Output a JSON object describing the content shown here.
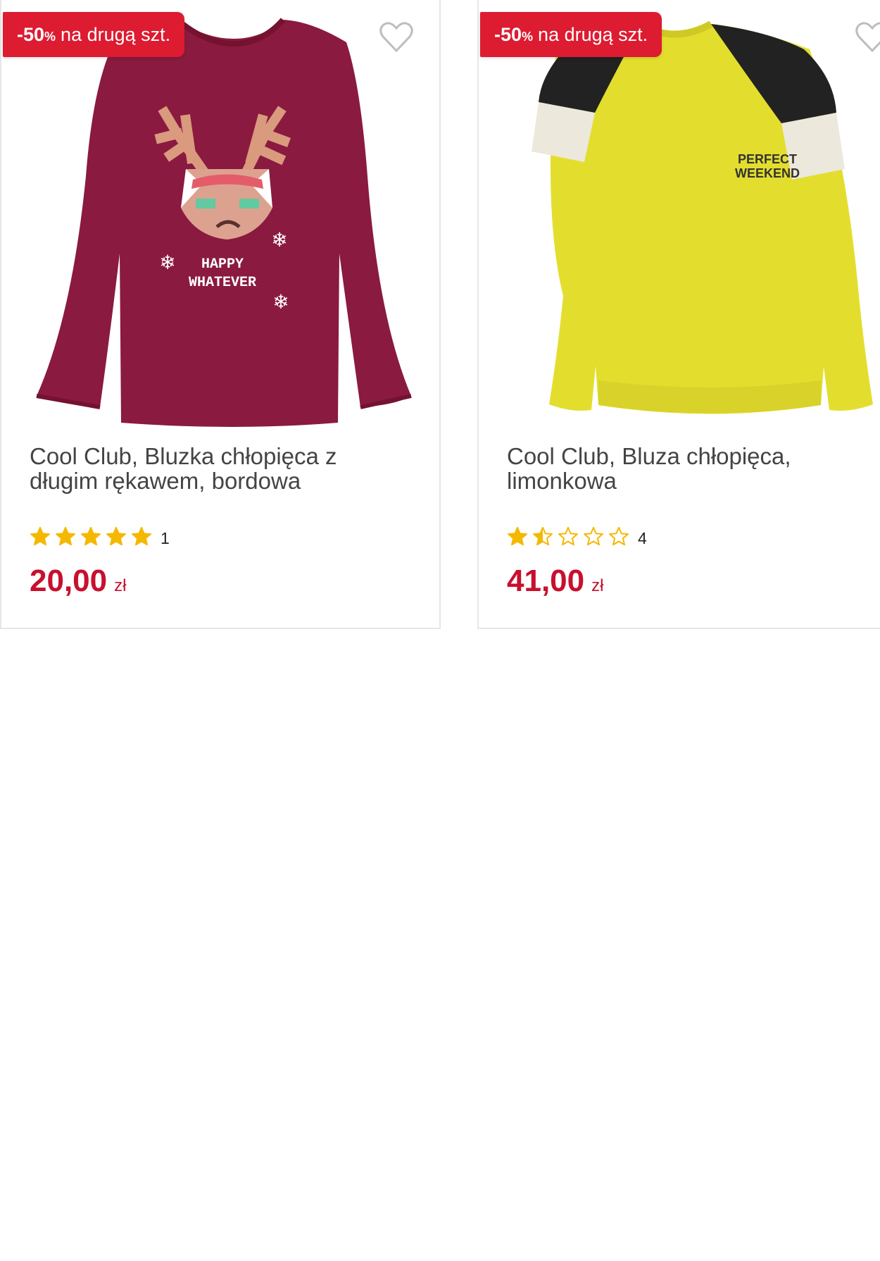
{
  "products": [
    {
      "badge": {
        "discount": "-50",
        "percent_sign": "%",
        "text": "na drugą szt."
      },
      "image_text": {
        "line1": "HAPPY",
        "line2": "WHATEVER"
      },
      "title": "Cool Club, Bluzka chłopięca z długim rękawem, bordowa",
      "rating": {
        "stars": 5,
        "max": 5,
        "count": "1"
      },
      "price": {
        "amount": "20,00",
        "currency": "zł"
      },
      "colors": {
        "garment": "#8a1a3f"
      }
    },
    {
      "badge": {
        "discount": "-50",
        "percent_sign": "%",
        "text": "na drugą szt."
      },
      "image_text": {
        "line1": "PERFECT",
        "line2": "WEEKEND"
      },
      "title": "Cool Club, Bluza chłopięca, limonkowa",
      "rating": {
        "stars": 1.5,
        "max": 5,
        "count": "4"
      },
      "price": {
        "amount": "41,00",
        "currency": "zł"
      },
      "colors": {
        "garment": "#e3de2e"
      }
    }
  ],
  "icons": {
    "favorite": "heart-outline-icon",
    "rating": "star-icon"
  },
  "theme": {
    "accent": "#dd1b31",
    "price": "#c8102e",
    "star": "#f5b800",
    "star_empty": "#c9c9c9"
  }
}
